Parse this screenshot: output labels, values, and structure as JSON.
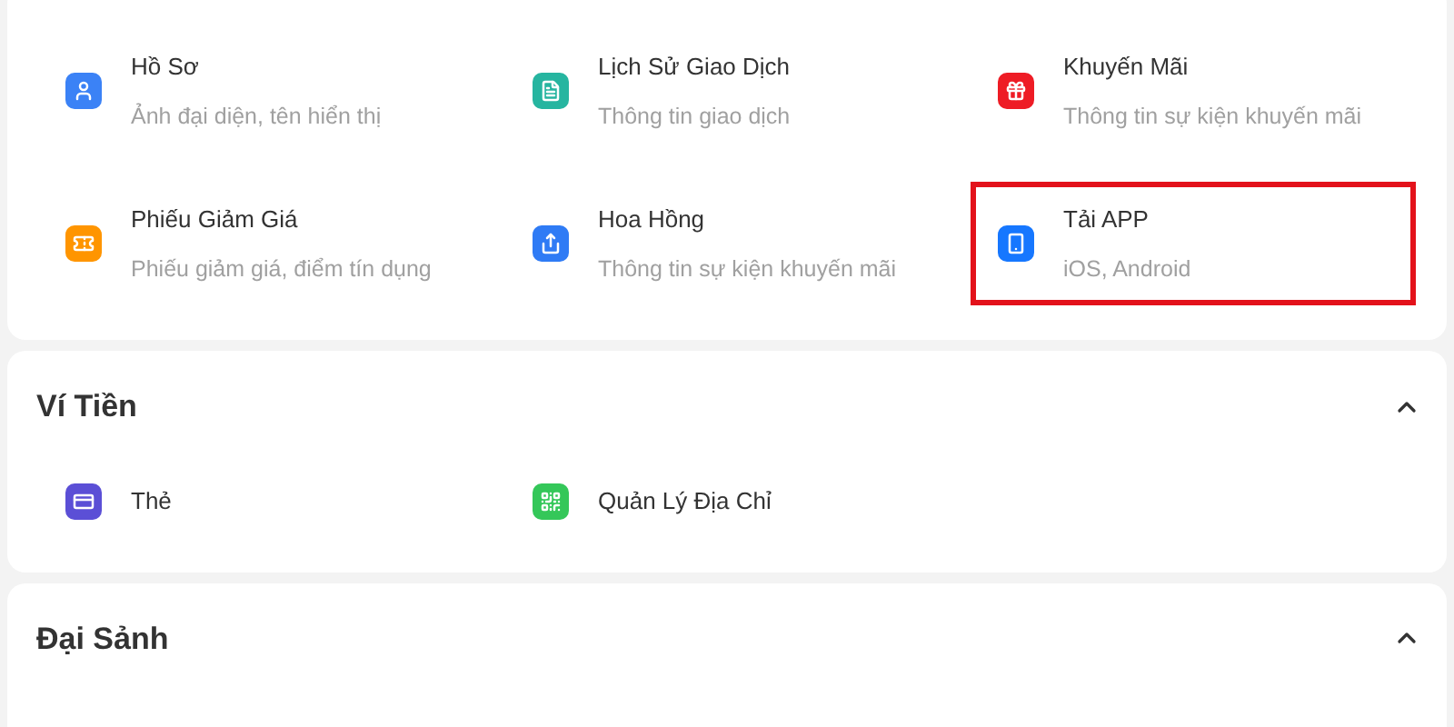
{
  "sections": [
    {
      "items": [
        {
          "title": "Hồ Sơ",
          "subtitle": "Ảnh đại diện, tên hiển thị",
          "color": "#3b82f6",
          "highlighted": false
        },
        {
          "title": "Lịch Sử Giao Dịch",
          "subtitle": "Thông tin giao dịch",
          "color": "#26b5a0",
          "highlighted": false
        },
        {
          "title": "Khuyến Mãi",
          "subtitle": "Thông tin sự kiện khuyến mãi",
          "color": "#ee1c25",
          "highlighted": false
        },
        {
          "title": "Phiếu Giảm Giá",
          "subtitle": "Phiếu giảm giá, điểm tín dụng",
          "color": "#ff9500",
          "highlighted": false
        },
        {
          "title": "Hoa Hồng",
          "subtitle": "Thông tin sự kiện khuyến mãi",
          "color": "#2f7bf5",
          "highlighted": false
        },
        {
          "title": "Tải APP",
          "subtitle": "iOS, Android",
          "color": "#1677ff",
          "highlighted": true
        }
      ]
    },
    {
      "title": "Ví Tiền",
      "expanded": true,
      "items": [
        {
          "title": "Thẻ",
          "color": "#5b4fd6",
          "highlighted": false
        },
        {
          "title": "Quản Lý Địa Chỉ",
          "color": "#34c759",
          "highlighted": false
        }
      ]
    },
    {
      "title": "Đại Sảnh",
      "expanded": true
    }
  ]
}
